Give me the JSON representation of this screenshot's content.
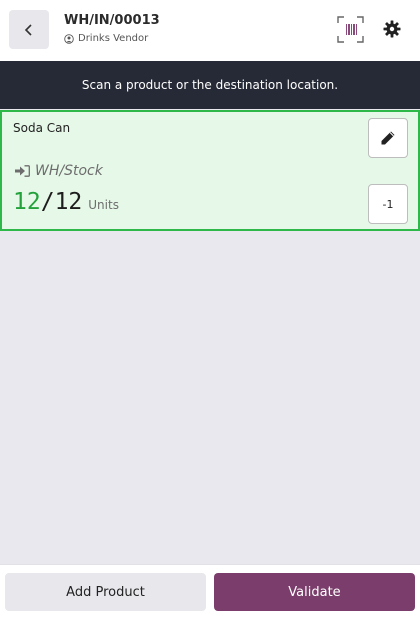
{
  "header": {
    "reference": "WH/IN/00013",
    "partner": "Drinks Vendor",
    "icons": {
      "back": "chevron-left-icon",
      "partner": "user-circle-icon",
      "barcode": "barcode-scan-icon",
      "settings": "gear-icon"
    }
  },
  "banner": {
    "message": "Scan a product or the destination location."
  },
  "lines": [
    {
      "product": "Soda Can",
      "location": "WH/Stock",
      "qty_done": "12",
      "separator": "/",
      "qty_demand": "12",
      "uom": "Units",
      "decrement_label": "-1"
    }
  ],
  "footer": {
    "add_product_label": "Add Product",
    "validate_label": "Validate"
  },
  "colors": {
    "banner_bg": "#262a36",
    "line_highlight_bg": "#e6f8e8",
    "line_highlight_border": "#2fb84a",
    "qty_done_color": "#23a23c",
    "validate_bg": "#7b3e6c"
  }
}
